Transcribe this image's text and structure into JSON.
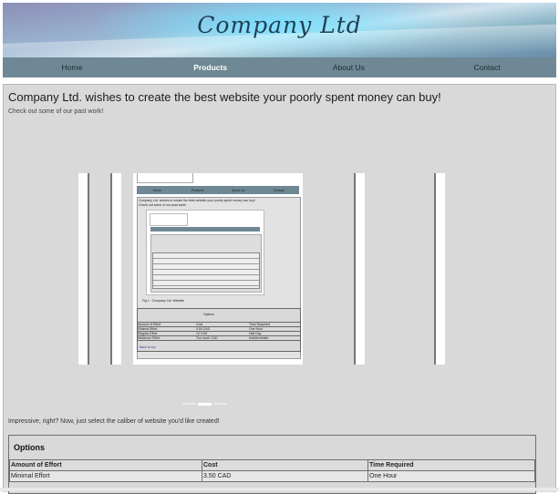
{
  "header": {
    "logo_text": "Company Ltd"
  },
  "nav": {
    "items": [
      {
        "label": "Home",
        "active": false
      },
      {
        "label": "Products",
        "active": true
      },
      {
        "label": "About Us",
        "active": false
      },
      {
        "label": "Contact",
        "active": false
      }
    ]
  },
  "main": {
    "headline": "Company Ltd. wishes to create the best website your poorly spent money can buy!",
    "subtext": "Check out some of our past work!",
    "carousel": {
      "indicators": 3,
      "active_index": 1,
      "slide": {
        "nav": [
          "Home",
          "Products",
          "About Us",
          "Contact"
        ],
        "headline": "Company Ltd. wishes to create the best website your poorly spent money can buy!",
        "sub": "Check out some of our past work!",
        "caption": "Fig 1 : Company Ltd. Website",
        "options_title": "Options",
        "rows": [
          [
            "Amount of Effort",
            "Cost",
            "Time Required"
          ],
          [
            "Minimal Effort",
            "3.50 CAD",
            "One Hour"
          ],
          [
            "Regular Effort",
            "10 CAD",
            "Half Day"
          ],
          [
            "Maximum Effort",
            "Too much CAD",
            "Indeterminate"
          ]
        ],
        "link": "Back to top"
      }
    },
    "prompt": "Impressive, right? Now, just select the caliber of website you'd like created!"
  },
  "options": {
    "title": "Options",
    "columns": [
      "Amount of Effort",
      "Cost",
      "Time Required"
    ],
    "rows": [
      [
        "Minimal Effort",
        "3.50 CAD",
        "One Hour"
      ]
    ]
  },
  "colors": {
    "nav_bg": "#6e8895",
    "panel_bg": "#d9d9d9",
    "active_nav_text": "#ffffff"
  }
}
